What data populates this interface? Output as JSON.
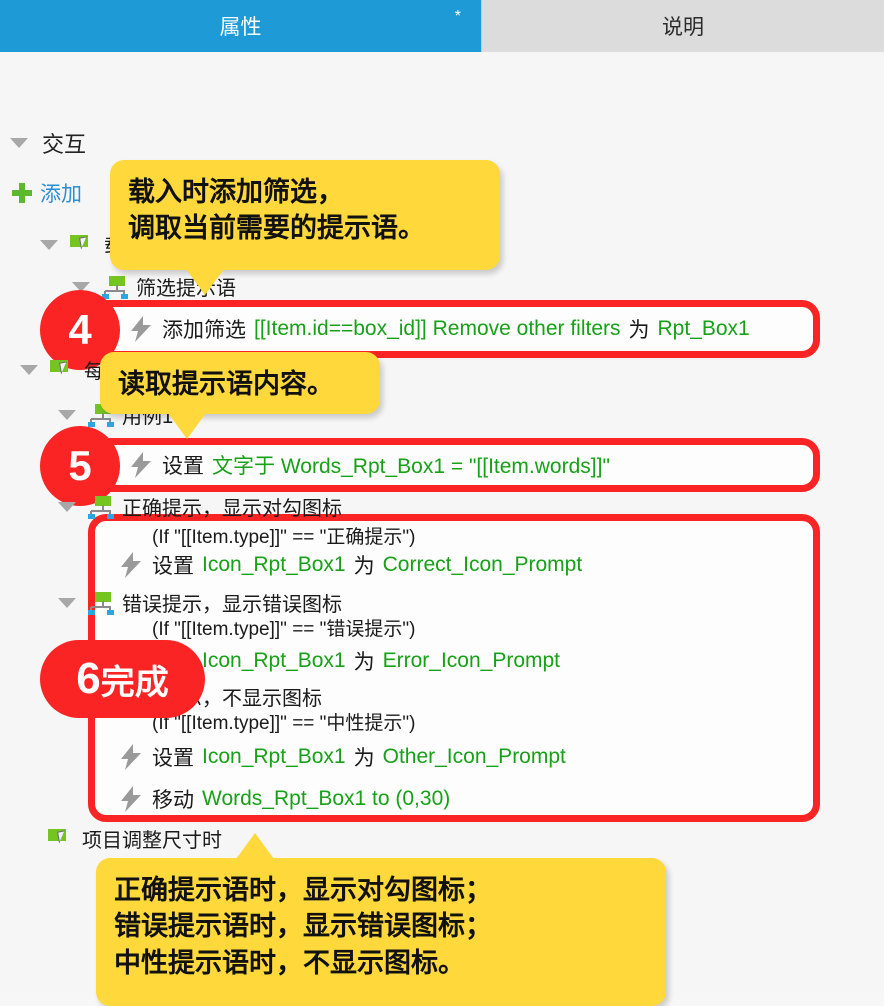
{
  "tabs": [
    {
      "label": "属性",
      "star": "*",
      "active": true
    },
    {
      "label": "说明",
      "active": false
    }
  ],
  "tree": {
    "group_title": "交互",
    "add_link": "添加",
    "nodes": {
      "event_load": "载入时",
      "case_filter": "筛选提示语",
      "event_each_item_load": "每项加载时",
      "case_hidden": "用例1",
      "case_correct": "正确提示，显示对勾图标",
      "cond_correct": "(If \"[[Item.type]]\" == \"正确提示\")",
      "case_error": "错误提示，显示错误图标",
      "cond_error": "(If \"[[Item.type]]\" == \"错误提示\")",
      "case_neutral": "中性提示，不显示图标",
      "cond_neutral": "(If \"[[Item.type]]\" == \"中性提示\")",
      "event_item_resize": "项目调整尺寸时"
    },
    "actions": {
      "add_filter": {
        "verb": "添加筛选",
        "expr": "[[Item.id==box_id]] Remove other filters",
        "conn": "为",
        "target": "Rpt_Box1"
      },
      "set_text": {
        "verb": "设置",
        "expr": "文字于 Words_Rpt_Box1 = \"[[Item.words]]\""
      },
      "set_correct_icon": {
        "verb": "设置",
        "obj": "Icon_Rpt_Box1",
        "conn": "为",
        "target": "Correct_Icon_Prompt"
      },
      "set_error_icon": {
        "verb": "设置",
        "obj": "Icon_Rpt_Box1",
        "conn": "为",
        "target": "Error_Icon_Prompt"
      },
      "set_other_icon": {
        "verb": "设置",
        "obj": "Icon_Rpt_Box1",
        "conn": "为",
        "target": "Other_Icon_Prompt"
      },
      "move_words": {
        "verb": "移动",
        "expr": "Words_Rpt_Box1 to (0,30)"
      }
    }
  },
  "badges": {
    "step4": "4",
    "step5": "5",
    "step6_num": "6",
    "step6_text": "完成"
  },
  "callouts": {
    "one": [
      "载入时添加筛选，",
      "调取当前需要的提示语。"
    ],
    "two": [
      "读取提示语内容。"
    ],
    "three": [
      "正确提示语时，显示对勾图标；",
      "错误提示语时，显示错误图标；",
      "中性提示语时，不显示图标。"
    ]
  },
  "colors": {
    "tab_active": "#1e9ad6",
    "tab_inactive": "#dcdcdc",
    "highlight_red": "#fb2424",
    "callout_yellow": "#ffd93b",
    "action_green": "#17a117",
    "link_blue": "#2b8fd4",
    "icon_green": "#74c520"
  }
}
